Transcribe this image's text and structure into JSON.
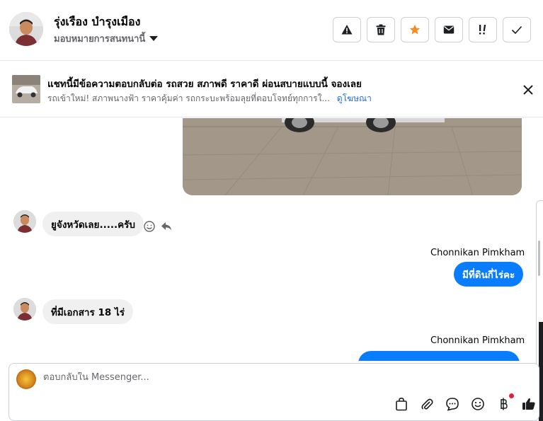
{
  "header": {
    "contact_name": "รุ่งเรือง บำรุงเมือง",
    "assign_label": "มอบหมายการสนทนานี้",
    "actions": [
      {
        "name": "report-button",
        "icon": "warning-icon"
      },
      {
        "name": "delete-button",
        "icon": "trash-icon"
      },
      {
        "name": "star-button",
        "icon": "star-icon"
      },
      {
        "name": "mark-unread-button",
        "icon": "envelope-icon"
      },
      {
        "name": "follow-up-button",
        "icon": "exclamation-icon"
      },
      {
        "name": "done-button",
        "icon": "check-icon"
      }
    ],
    "star_color": "#f28c28"
  },
  "ad": {
    "title": "แชทนี้มีข้อความตอบกลับต่อ รถสวย สภาพดี ราคาดี ผ่อนสบายแบบนี้ จองเลย",
    "subtitle": "รถเข้าใหม่! สภาพนางฟ้า ราคาคุ้มค่า รถกระบะพร้อมลุยที่ตอบโจทย์ทุกการใ...",
    "link": "ดูโฆษณา"
  },
  "messages": [
    {
      "direction": "in",
      "text": "ยูจังหวัดเลย.....ครับ"
    },
    {
      "direction": "out",
      "sender": "Chonnikan Pimkham",
      "text": "มีที่ดินกี่ไร่คะ"
    },
    {
      "direction": "in",
      "text": "ที่มีเอกสาร  18  ไร่"
    },
    {
      "direction": "out",
      "sender": "Chonnikan Pimkham",
      "text": ""
    }
  ],
  "composer": {
    "placeholder": "ตอบกลับใน Messenger...",
    "tools": [
      "shopping-bag-icon",
      "paperclip-icon",
      "chat-bubble-icon",
      "emoji-icon",
      "baht-icon",
      "thumbs-up-icon"
    ]
  },
  "colors": {
    "outgoing_bubble": "#0a7cff",
    "incoming_bubble": "#f0f0f0",
    "link": "#216fdb",
    "notification_dot": "#e41e3f"
  }
}
